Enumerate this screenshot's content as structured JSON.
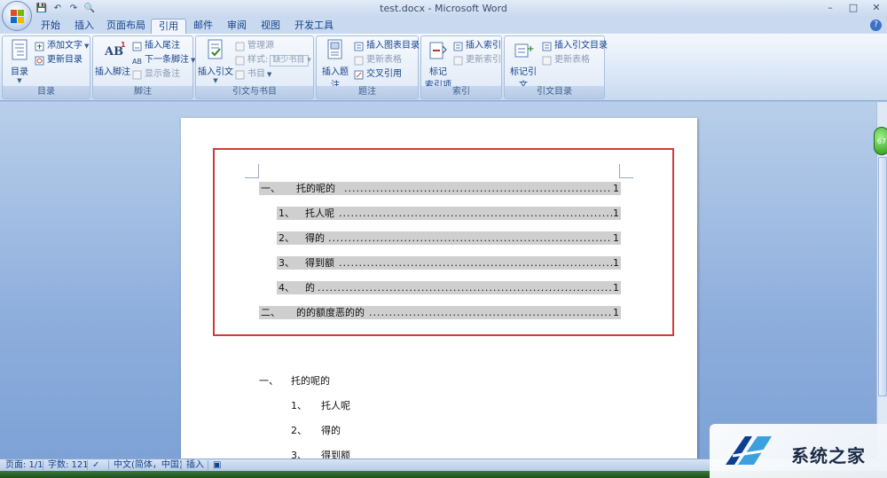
{
  "window": {
    "title": "test.docx - Microsoft Word",
    "minimize": "–",
    "maximize": "□",
    "close": "✕"
  },
  "qat": {
    "save": "💾",
    "undo": "↶",
    "redo": "↷",
    "preview": "🔍"
  },
  "tabs": [
    {
      "label": "开始"
    },
    {
      "label": "插入"
    },
    {
      "label": "页面布局"
    },
    {
      "label": "引用",
      "active": true
    },
    {
      "label": "邮件"
    },
    {
      "label": "审阅"
    },
    {
      "label": "视图"
    },
    {
      "label": "开发工具"
    }
  ],
  "ribbon": {
    "toc_group": {
      "label": "目录",
      "toc": "目录",
      "add_text": "添加文字",
      "update_toc": "更新目录"
    },
    "footnote_group": {
      "label": "脚注",
      "insert_footnote": "插入脚注",
      "insert_endnote": "插入尾注",
      "next_footnote": "下一条脚注",
      "show_notes": "显示备注"
    },
    "citation_group": {
      "label": "引文与书目",
      "insert_citation": "插入引文",
      "manage_sources": "管理源",
      "style_label": "样式:",
      "style_value": "缺少书目",
      "bibliography": "书目"
    },
    "caption_group": {
      "label": "题注",
      "insert_caption": "插入题注",
      "insert_figure_table": "插入图表目录",
      "update_table": "更新表格",
      "cross_reference": "交叉引用"
    },
    "index_group": {
      "label": "索引",
      "mark_entry_1": "标记",
      "mark_entry_2": "索引项",
      "insert_index": "插入索引",
      "update_index": "更新索引"
    },
    "toa_group": {
      "label": "引文目录",
      "mark_citation": "标记引文",
      "insert_toa": "插入引文目录",
      "update_table": "更新表格"
    }
  },
  "document": {
    "toc": [
      {
        "num": "一、",
        "text": "托的呢的",
        "page": "1",
        "level": 1
      },
      {
        "num": "1、",
        "text": "托人呢",
        "page": "1",
        "level": 2
      },
      {
        "num": "2、",
        "text": "得的",
        "page": "1",
        "level": 2
      },
      {
        "num": "3、",
        "text": "得到额",
        "page": "1",
        "level": 2
      },
      {
        "num": "4、",
        "text": "的",
        "page": "1",
        "level": 2
      },
      {
        "num": "二、",
        "text": "的的额度恶的的",
        "page": "1",
        "level": 1
      }
    ],
    "body": [
      {
        "num": "一、",
        "text": "托的呢的"
      },
      {
        "num": "1、",
        "text": "托人呢"
      },
      {
        "num": "2、",
        "text": "得的"
      },
      {
        "num": "3、",
        "text": "得到额"
      }
    ],
    "zoom_badge": "67"
  },
  "status": {
    "page": "页面: 1/1",
    "words": "字数: 121",
    "language": "中文(简体，中国)",
    "mode": "插入"
  },
  "watermark": {
    "text": "系统之家"
  },
  "colors": {
    "highlight_border": "#d03a3a",
    "toc_field_shading": "#cfcfcf",
    "ribbon_text": "#15428b"
  }
}
